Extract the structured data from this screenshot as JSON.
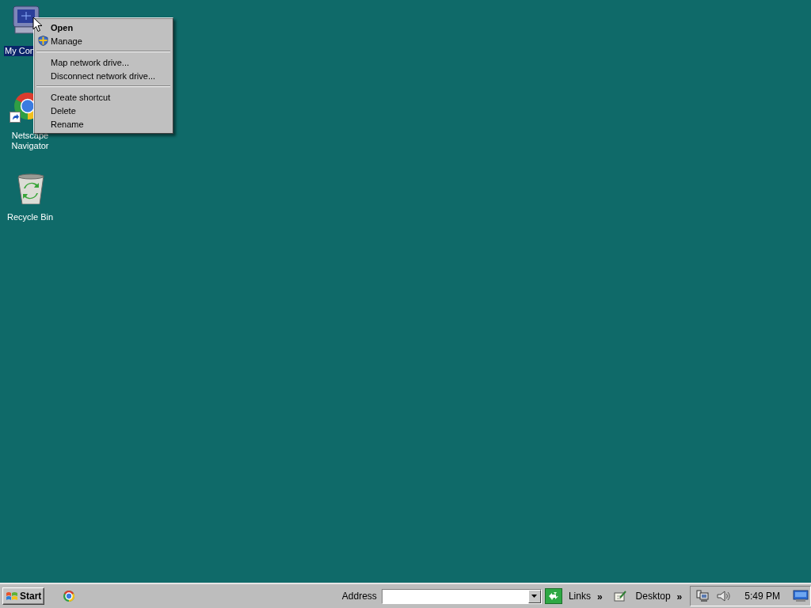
{
  "desktop_icons": [
    {
      "kind": "computer",
      "label": "My Con",
      "selected": true,
      "shortcut": false
    },
    {
      "kind": "browser",
      "label": "Netscape Navigator",
      "selected": false,
      "shortcut": true
    },
    {
      "kind": "recycle",
      "label": "Recycle Bin",
      "selected": false,
      "shortcut": false
    }
  ],
  "context_menu": {
    "items": [
      {
        "kind": "item",
        "label": "Open",
        "default": true
      },
      {
        "kind": "shield_item",
        "label": "Manage",
        "default": false
      },
      {
        "kind": "separator"
      },
      {
        "kind": "item",
        "label": "Map network drive...",
        "default": false
      },
      {
        "kind": "item",
        "label": "Disconnect network drive...",
        "default": false
      },
      {
        "kind": "separator"
      },
      {
        "kind": "item",
        "label": "Create shortcut",
        "default": false
      },
      {
        "kind": "item",
        "label": "Delete",
        "default": false
      },
      {
        "kind": "item",
        "label": "Rename",
        "default": false
      }
    ]
  },
  "taskbar": {
    "start": {
      "label": "Start"
    },
    "quick_launch": [
      {
        "kind": "browser"
      }
    ],
    "address_bar": {
      "label": "Address"
    },
    "toolbars": [
      {
        "kind": "links",
        "label": "Links",
        "chevron": "»"
      },
      {
        "kind": "folder",
        "label": "Desktop",
        "chevron": "»"
      }
    ],
    "tray": {
      "icons": [
        {
          "kind": "network"
        },
        {
          "kind": "speaker"
        }
      ],
      "clock": "5:49 PM",
      "trailing_icons": [
        {
          "kind": "monitor"
        }
      ]
    }
  }
}
